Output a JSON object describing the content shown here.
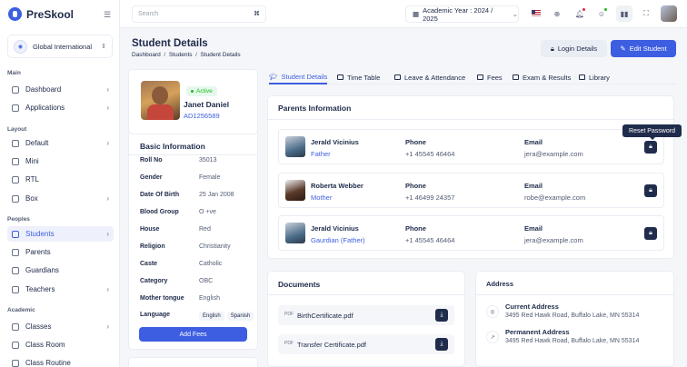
{
  "app": {
    "name": "PreSkool"
  },
  "school": {
    "name": "Global International"
  },
  "sidebar": {
    "sections": [
      "Main",
      "Layout",
      "Peoples",
      "Academic"
    ],
    "items": [
      {
        "label": "Dashboard"
      },
      {
        "label": "Applications"
      },
      {
        "label": "Default"
      },
      {
        "label": "Mini"
      },
      {
        "label": "RTL"
      },
      {
        "label": "Box"
      },
      {
        "label": "Students"
      },
      {
        "label": "Parents"
      },
      {
        "label": "Guardians"
      },
      {
        "label": "Teachers"
      },
      {
        "label": "Classes"
      },
      {
        "label": "Class Room"
      },
      {
        "label": "Class Routine"
      }
    ]
  },
  "topbar": {
    "search_placeholder": "Search",
    "search_kbd": "⌘",
    "academic_year": "Academic Year : 2024 / 2025"
  },
  "page": {
    "title": "Student Details",
    "breadcrumb": [
      "Dashboard",
      "Students",
      "Student Details"
    ],
    "login_button": "Login Details",
    "edit_button": "Edit Student"
  },
  "profile": {
    "status": "Active",
    "name": "Janet  Daniel",
    "id": "AD1256589"
  },
  "basic_info": {
    "title": "Basic Information",
    "rows": [
      {
        "k": "Roll No",
        "v": "35013"
      },
      {
        "k": "Gender",
        "v": "Female"
      },
      {
        "k": "Date Of Birth",
        "v": "25 Jan 2008"
      },
      {
        "k": "Blood Group",
        "v": "O +ve"
      },
      {
        "k": "House",
        "v": "Red"
      },
      {
        "k": "Religion",
        "v": "Christianity"
      },
      {
        "k": "Caste",
        "v": "Catholic"
      },
      {
        "k": "Category",
        "v": "OBC"
      },
      {
        "k": "Mother tongue",
        "v": "English"
      }
    ],
    "language_label": "Language",
    "languages": [
      "English",
      "Spanish"
    ],
    "add_fees": "Add Fees"
  },
  "tabs": [
    {
      "label": "Student Details"
    },
    {
      "label": "Time Table"
    },
    {
      "label": "Leave & Attendance"
    },
    {
      "label": "Fees"
    },
    {
      "label": "Exam & Results"
    },
    {
      "label": "Library"
    }
  ],
  "parents": {
    "title": "Parents Information",
    "phone_label": "Phone",
    "email_label": "Email",
    "tooltip": "Reset Password",
    "rows": [
      {
        "name": "Jerald Vicinius",
        "role": "Father",
        "phone": "+1 45545 46464",
        "email": "jera@example.com"
      },
      {
        "name": "Roberta Webber",
        "role": "Mother",
        "phone": "+1 46499 24357",
        "email": "robe@example.com"
      },
      {
        "name": "Jerald Vicinius",
        "role": "Gaurdian (Father)",
        "phone": "+1 45545 46464",
        "email": "jera@example.com"
      }
    ]
  },
  "documents": {
    "title": "Documents",
    "files": [
      {
        "name": "BirthCertificate.pdf",
        "tag": "PDF"
      },
      {
        "name": "Transfer Certificate.pdf",
        "tag": "PDF"
      }
    ]
  },
  "address": {
    "title": "Address",
    "rows": [
      {
        "label": "Current Address",
        "value": "3495 Red Hawk Road, Buffalo Lake, MN 55314"
      },
      {
        "label": "Permanent Address",
        "value": "3495 Red Hawk Road, Buffalo Lake, MN 55314"
      }
    ]
  }
}
